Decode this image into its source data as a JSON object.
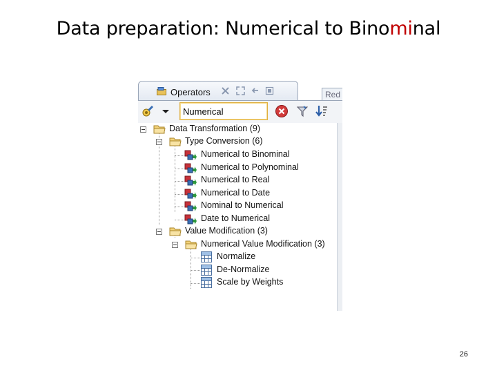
{
  "slide": {
    "title_main": "Data preparation: Numerical to Bino",
    "title_highlight": "mi",
    "title_tail": "nal",
    "page_number": "26"
  },
  "panel": {
    "tab_label": "Operators",
    "next_tab_label": "Red",
    "search": {
      "value": "Numerical",
      "placeholder": ""
    }
  },
  "tree": {
    "data_transformation": "Data Transformation (9)",
    "type_conversion": "Type Conversion (6)",
    "type_items": [
      "Numerical to Binominal",
      "Numerical to Polynominal",
      "Numerical to Real",
      "Numerical to Date",
      "Nominal to Numerical",
      "Date to Numerical"
    ],
    "value_modification": "Value Modification (3)",
    "numerical_value_modification": "Numerical Value Modification (3)",
    "value_items": [
      "Normalize",
      "De-Normalize",
      "Scale by Weights"
    ]
  },
  "colors": {
    "title_highlight": "#c00000",
    "search_border": "#e0b040",
    "clear_button": "#d23b3b"
  },
  "icons": [
    "operators-icon",
    "wand-icon",
    "dropdown-arrow-icon",
    "clear-icon",
    "filter-icon",
    "sort-icon",
    "folder-icon",
    "operator-icon",
    "grid-icon"
  ]
}
